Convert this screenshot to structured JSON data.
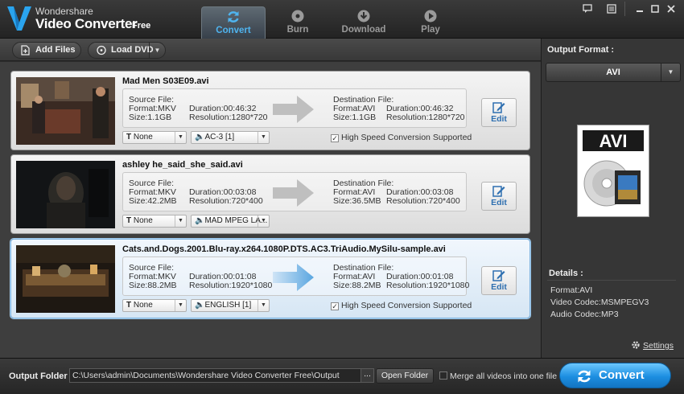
{
  "app": {
    "brand_small": "Wondershare",
    "brand_main": "Video Converter",
    "brand_edition": "Free"
  },
  "tabs": [
    {
      "label": "Convert",
      "icon": "convert-refresh-icon",
      "active": true
    },
    {
      "label": "Burn",
      "icon": "disc-icon",
      "active": false
    },
    {
      "label": "Download",
      "icon": "download-icon",
      "active": false
    },
    {
      "label": "Play",
      "icon": "play-icon",
      "active": false
    }
  ],
  "window_controls": [
    "chat-icon",
    "menu-list-icon",
    "minimize-icon",
    "maximize-icon",
    "close-icon"
  ],
  "toolbar": {
    "add_files": "Add Files",
    "load_dvd": "Load DVD"
  },
  "labels": {
    "source_file": "Source File:",
    "destination_file": "Destination File:",
    "edit": "Edit",
    "high_speed": "High Speed Conversion Supported"
  },
  "files": [
    {
      "name": "Mad Men S03E09.avi",
      "src_format": "Format:MKV",
      "src_size": "Size:1.1GB",
      "src_duration": "Duration:00:46:32",
      "src_resolution": "Resolution:1280*720",
      "dst_format": "Format:AVI",
      "dst_size": "Size:1.1GB",
      "dst_duration": "Duration:00:46:32",
      "dst_resolution": "Resolution:1280*720",
      "subtitle": "None",
      "audio": "AC-3 [1]",
      "high_speed_visible": true
    },
    {
      "name": "ashley he_said_she_said.avi",
      "src_format": "Format:MKV",
      "src_size": "Size:42.2MB",
      "src_duration": "Duration:00:03:08",
      "src_resolution": "Resolution:720*400",
      "dst_format": "Format:AVI",
      "dst_size": "Size:36.5MB",
      "dst_duration": "Duration:00:03:08",
      "dst_resolution": "Resolution:720*400",
      "subtitle": "None",
      "audio": "MAD MPEG LA...",
      "high_speed_visible": false
    },
    {
      "name": "Cats.and.Dogs.2001.Blu-ray.x264.1080P.DTS.AC3.TriAudio.MySilu-sample.avi",
      "src_format": "Format:MKV",
      "src_size": "Size:88.2MB",
      "src_duration": "Duration:00:01:08",
      "src_resolution": "Resolution:1920*1080",
      "dst_format": "Format:AVI",
      "dst_size": "Size:88.2MB",
      "dst_duration": "Duration:00:01:08",
      "dst_resolution": "Resolution:1920*1080",
      "subtitle": "None",
      "audio": "ENGLISH [1]",
      "high_speed_visible": true
    }
  ],
  "output": {
    "label": "Output Format :",
    "format": "AVI",
    "preview_label": "AVI",
    "details_label": "Details :",
    "details": [
      "Format:AVI",
      "Video Codec:MSMPEGV3",
      "Audio Codec:MP3"
    ],
    "settings": "Settings"
  },
  "bottom": {
    "folder_label": "Output Folder :",
    "folder_path": "C:\\Users\\admin\\Documents\\Wondershare Video Converter Free\\Output",
    "browse": "...",
    "open_folder": "Open Folder",
    "merge_label": "Merge all videos into one file",
    "convert": "Convert"
  },
  "colors": {
    "accent_blue": "#1c8ee0",
    "active_tab_text": "#4fb4ef",
    "edit_text": "#2e6fb0"
  }
}
